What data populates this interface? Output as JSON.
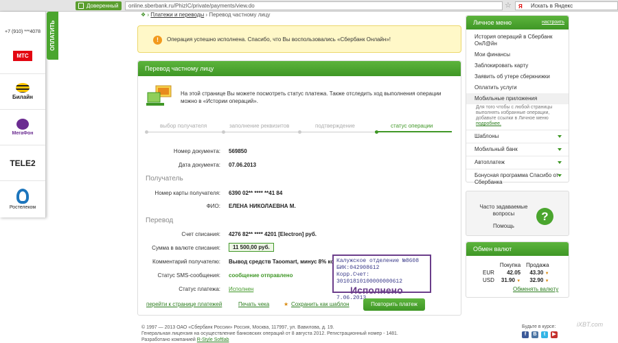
{
  "browser": {
    "secure_label": "Доверенный",
    "url": "online.sberbank.ru/PhizIC/private/payments/view.do",
    "search_placeholder": "Искать в Яндекс",
    "search_logo": "Я"
  },
  "left": {
    "phone": "+7 (910) ***4078",
    "operators": [
      "МТС",
      "Билайн",
      "МегаФон",
      "TELE2",
      "Ростелеком"
    ],
    "pay_tab": "ОПЛАТИТЬ"
  },
  "breadcrumb": {
    "link": "Платежи и переводы",
    "separator": "›",
    "current": "Перевод частному лицу"
  },
  "success_message": "Операция успешно исполнена. Спасибо, что Вы воспользовались «Сбербанк Онлайн»!",
  "transfer": {
    "title": "Перевод частному лицу",
    "intro": "На этой странице Вы можете посмотреть статус платежа. Также отследить ход выполнения операции можно в «Истории операций».",
    "steps": [
      "выбор получателя",
      "заполнение реквизитов",
      "подтверждение",
      "статус операции"
    ],
    "doc_number_label": "Номер документа:",
    "doc_number": "569850",
    "doc_date_label": "Дата документа:",
    "doc_date": "07.06.2013",
    "recipient_section": "Получатель",
    "card_label": "Номер карты получателя:",
    "card_value": "6390 02** **** **41 84",
    "fio_label": "ФИО:",
    "fio_value": "ЕЛЕНА НИКОЛАЕВНА М.",
    "transfer_section": "Перевод",
    "account_label": "Счет списания:",
    "account_value": "4276 82** **** 4201 [Electron] руб.",
    "sum_label": "Сумма в валюте списания:",
    "sum_value": "11 500,00 руб.",
    "comment_label": "Комментарий получателю:",
    "comment_value": "Вывод средств Taoomart, минус 8% ко",
    "sms_label": "Статус SMS-сообщения:",
    "sms_value": "сообщение отправлено",
    "status_label": "Статус платежа:",
    "status_value": "Исполнен"
  },
  "stamp": {
    "line1": "Калужское отделение №8608",
    "line2": "БИК:042908612",
    "line3": "Корр.Счет: 30101810100000000612",
    "big": "Исполнено",
    "date": "7.06.2013"
  },
  "actions": {
    "back_link": "перейти к странице платежей",
    "print": "Печать чека",
    "save_template": "Сохранить как шаблон",
    "repeat": "Повторить платеж"
  },
  "footer": {
    "line1": "© 1997 — 2013 ОАО «Сбербанк России» Россия, Москва, 117997, ул. Вавилова, д. 19.",
    "line2": "Генеральная лицензия на осуществление банковских операций от 8 августа 2012. Регистрационный номер - 1481.",
    "line3_prefix": "Разработано компанией",
    "line3_link": "R-Style Softlab",
    "social_label": "Будьте в курсе:",
    "social_icons": [
      "f",
      "В",
      "t",
      "▶"
    ]
  },
  "personal_menu": {
    "title": "Личное меню",
    "settings": "настроить",
    "items": [
      "История операций в Сбербанк ОнЛ@йн",
      "Мои финансы",
      "Заблокировать карту",
      "Заявить об утере сберкнижки",
      "Оплатить услуги",
      "Мобильные приложения"
    ],
    "hint": "Для того чтобы с любой страницы выполнять избранные операции, добавьте ссылки в Личное меню",
    "hint_link": "подробнее.",
    "accordion": [
      "Шаблоны",
      "Мобильный банк",
      "Автоплатеж",
      "Бонусная программа Спасибо от Сбербанка"
    ]
  },
  "faq": {
    "question": "Часто задаваемые вопросы",
    "help": "Помощь",
    "icon": "?"
  },
  "exchange": {
    "title": "Обмен валют",
    "buy_label": "Покупка",
    "sell_label": "Продажа",
    "rows": [
      {
        "cur": "EUR",
        "buy": "42.05",
        "sell": "43.30"
      },
      {
        "cur": "USD",
        "buy": "31.90",
        "sell": "32.90"
      }
    ],
    "link": "Обменять валюту"
  },
  "watermark": "iXBT.com",
  "colors": {
    "brand_green": "#3f9726",
    "success_bg": "#fff8c8",
    "stamp": "#6a3c8a"
  }
}
